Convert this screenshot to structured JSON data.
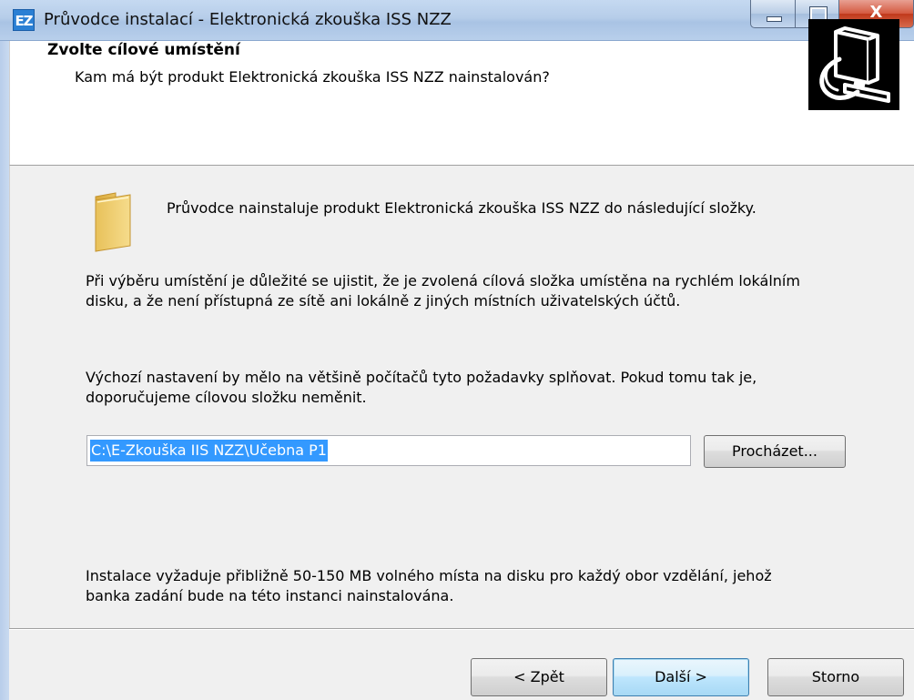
{
  "window": {
    "title": "Průvodce instalací - Elektronická zkouška ISS NZZ",
    "app_icon_text": "EZ",
    "close_glyph": "X"
  },
  "header": {
    "title": "Zvolte cílové umístění",
    "subtitle": "Kam má být produkt Elektronická zkouška ISS NZZ nainstalován?",
    "logo_icon": "computer-install-icon"
  },
  "body": {
    "intro": "Průvodce nainstaluje produkt Elektronická zkouška ISS NZZ do následující složky.",
    "para1": "Při výběru umístění je důležité se ujistit, že je zvolená cílová složka umístěna na rychlém lokálním disku, a že není přístupná ze sítě ani lokálně z jiných místních uživatelských účtů.",
    "para2": "Výchozí nastavení by mělo na většině počítačů tyto požadavky splňovat. Pokud tomu tak je, doporučujeme cílovou složku neměnit.",
    "path_value": "C:\\E-Zkouška IIS NZZ\\Učebna P1",
    "browse_label": "Procházet...",
    "space_note": "Instalace vyžaduje přibližně 50-150 MB volného místa na disku pro každý obor vzdělání, jehož banka zadání bude na této instanci nainstalována."
  },
  "footer": {
    "back_label": "< Zpět",
    "next_label": "Další >",
    "cancel_label": "Storno"
  }
}
